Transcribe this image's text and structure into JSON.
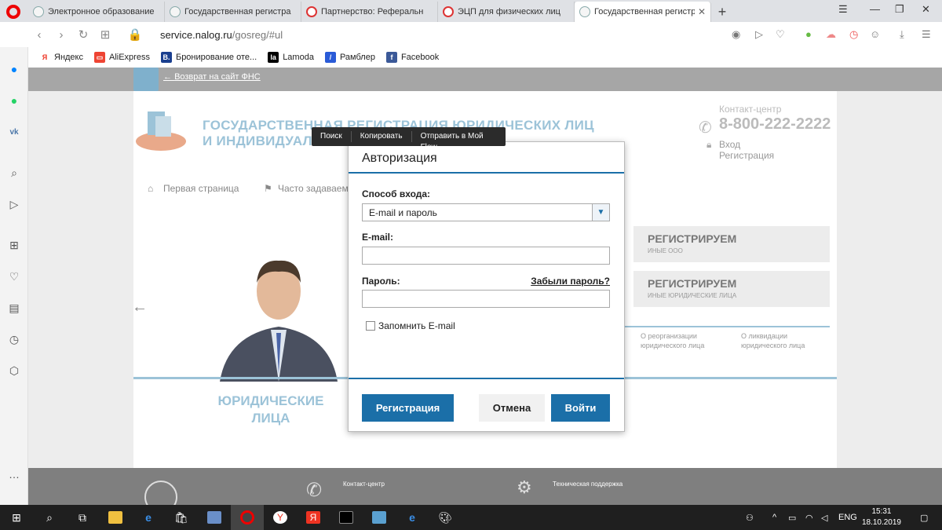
{
  "browser": {
    "tabs": [
      {
        "title": "Электронное образование",
        "active": false,
        "icon": "globe-icon"
      },
      {
        "title": "Государственная регистра",
        "active": false,
        "icon": "fns-icon"
      },
      {
        "title": "Партнерство: Реферальн",
        "active": false,
        "icon": "opera-cloud-icon"
      },
      {
        "title": "ЭЦП для физических лиц",
        "active": false,
        "icon": "opera-cloud-icon"
      },
      {
        "title": "Государственная регистра",
        "active": true,
        "icon": "fns-icon"
      }
    ],
    "address": {
      "url_host": "service.nalog.ru",
      "url_path": "/gosreg/#ul"
    },
    "bookmarks": [
      {
        "label": "Яндекс",
        "color": "#e32",
        "glyph": "Я"
      },
      {
        "label": "AliExpress",
        "color": "#e43",
        "glyph": "A"
      },
      {
        "label": "Бронирование оте...",
        "color": "#1a3f8f",
        "glyph": "B."
      },
      {
        "label": "Lamoda",
        "color": "#000",
        "glyph": "la"
      },
      {
        "label": "Рамблер",
        "color": "#2a5bd7",
        "glyph": "/"
      },
      {
        "label": "Facebook",
        "color": "#3b5998",
        "glyph": "f"
      }
    ]
  },
  "site": {
    "back_link": "Возврат на сайт ФНС",
    "title_line1": "ГОСУДАРСТВЕННАЯ РЕГИСТРАЦИЯ ЮРИДИЧЕСКИХ ЛИЦ",
    "title_line2": "И ИНДИВИДУАЛЬ",
    "contact_label": "Контакт-центр",
    "contact_phone": "8-800-222-2222",
    "login": "Вход",
    "register": "Регистрация",
    "menu": [
      "Первая страница",
      "Часто задаваем"
    ],
    "cards": [
      {
        "title": "РЕГИСТРИРУЕМ",
        "sub": "ИНЫЕ ООО"
      },
      {
        "title": "РЕГИСТРИРУЕМ",
        "sub": "ИНЫЕ ЮРИДИЧЕСКИЕ ЛИЦА"
      }
    ],
    "info": [
      {
        "line1": "О реорганизации",
        "line2": "юридического лица"
      },
      {
        "line1": "О ликвидации",
        "line2": "юридического лица"
      }
    ],
    "ul_title_1": "ЮРИДИЧЕСКИЕ",
    "ul_title_2": "ЛИЦА",
    "footer": {
      "contact": "Контакт-центр",
      "support": "Техническая поддержка"
    }
  },
  "context_menu": [
    "Поиск",
    "Копировать",
    "Отправить в Мой Flow"
  ],
  "modal": {
    "title": "Авторизация",
    "method_label": "Способ входа:",
    "method_value": "E-mail и пароль",
    "email_label": "E-mail:",
    "email_value": "",
    "password_label": "Пароль:",
    "password_value": "",
    "forgot": "Забыли пароль?",
    "remember": "Запомнить E-mail",
    "remember_checked": false,
    "btn_register": "Регистрация",
    "btn_cancel": "Отмена",
    "btn_login": "Войти"
  },
  "taskbar": {
    "lang": "ENG",
    "time": "15:31",
    "date": "18.10.2019"
  },
  "colors": {
    "accent": "#1b6fa8",
    "title": "#9cc3d8",
    "taskbar": "#1f1f1f"
  }
}
